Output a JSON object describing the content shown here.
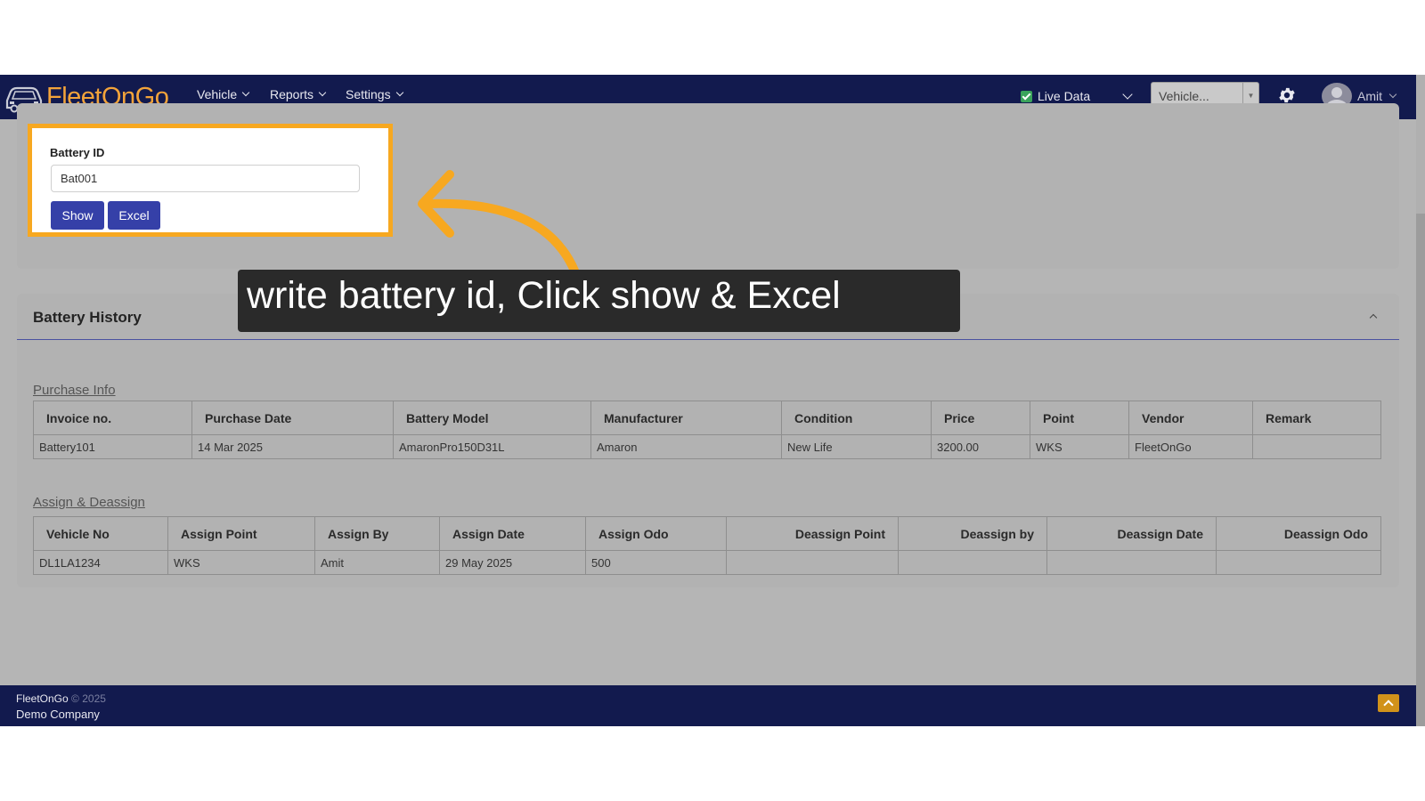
{
  "nav": {
    "logo_text_a": "Fleet",
    "logo_text_b": "On",
    "logo_text_c": "Go",
    "menu": [
      "Vehicle",
      "Reports",
      "Settings"
    ],
    "live_data_label": "Live Data",
    "vehicle_select_placeholder": "Vehicle...",
    "user_name": "Amit"
  },
  "filter": {
    "battery_id_label": "Battery ID",
    "battery_id_value": "Bat001",
    "show_label": "Show",
    "excel_label": "Excel"
  },
  "callout": {
    "text": "write battery id, Click show & Excel",
    "arrow_color": "#f7a820"
  },
  "history": {
    "title": "Battery History",
    "purchase_section_label": "Purchase Info",
    "purchase_columns": [
      "Invoice no.",
      "Purchase Date",
      "Battery Model",
      "Manufacturer",
      "Condition",
      "Price",
      "Point",
      "Vendor",
      "Remark"
    ],
    "purchase_rows": [
      [
        "Battery101",
        "14 Mar 2025",
        "AmaronPro150D31L",
        "Amaron",
        "New Life",
        "3200.00",
        "WKS",
        "FleetOnGo",
        ""
      ]
    ],
    "assign_section_label": "Assign & Deassign",
    "assign_columns": [
      "Vehicle No",
      "Assign Point",
      "Assign By",
      "Assign Date",
      "Assign Odo",
      "Deassign Point",
      "Deassign by",
      "Deassign Date",
      "Deassign Odo"
    ],
    "assign_rows": [
      [
        "DL1LA1234",
        "WKS",
        "Amit",
        "29 May 2025",
        "500",
        "",
        "",
        "",
        ""
      ]
    ]
  },
  "footer": {
    "brand": "FleetOnGo",
    "copyright": "© 2025",
    "company": "Demo Company"
  },
  "colors": {
    "navbar": "#121a4e",
    "button": "#3540a8",
    "highlight": "#f7a820",
    "logo": "#f2a33a"
  }
}
